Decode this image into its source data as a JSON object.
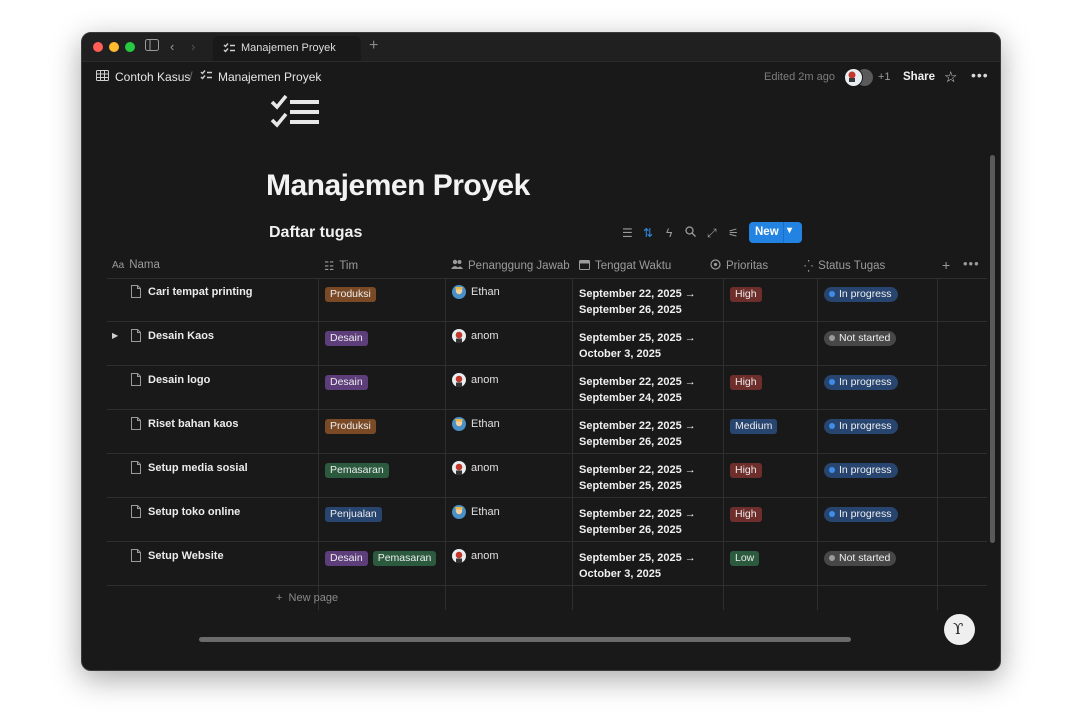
{
  "tab": {
    "label": "Manajemen Proyek"
  },
  "breadcrumb": [
    {
      "label": "Contoh Kasus",
      "icon": "table-icon"
    },
    {
      "label": "Manajemen Proyek",
      "icon": "checklist-icon"
    }
  ],
  "breadcrumb_sep": "/",
  "header": {
    "edited": "Edited 2m ago",
    "plus_count": "+1",
    "share": "Share"
  },
  "page": {
    "title": "Manajemen Proyek",
    "icon": "checklist-icon"
  },
  "view": {
    "title": "Daftar tugas",
    "new_label": "New"
  },
  "columns": [
    {
      "label": "Nama",
      "icon": "text-icon"
    },
    {
      "label": "Tim",
      "icon": "list-icon"
    },
    {
      "label": "Penanggung Jawab",
      "icon": "people-icon"
    },
    {
      "label": "Tenggat Waktu",
      "icon": "calendar-icon"
    },
    {
      "label": "Prioritas",
      "icon": "target-icon"
    },
    {
      "label": "Status Tugas",
      "icon": "loader-icon"
    }
  ],
  "rows": [
    {
      "name": "Cari tempat printing",
      "tags": [
        "Produksi"
      ],
      "person": "Ethan",
      "date1": "September 22, 2025 →",
      "date2": "September 26, 2025",
      "priority": "High",
      "status": "In progress"
    },
    {
      "name": "Desain Kaos",
      "tags": [
        "Desain"
      ],
      "person": "anom",
      "date1": "September 25, 2025 →",
      "date2": "October 3, 2025",
      "priority": "",
      "status": "Not started"
    },
    {
      "name": "Desain logo",
      "tags": [
        "Desain"
      ],
      "person": "anom",
      "date1": "September 22, 2025 →",
      "date2": "September 24, 2025",
      "priority": "High",
      "status": "In progress"
    },
    {
      "name": "Riset bahan kaos",
      "tags": [
        "Produksi"
      ],
      "person": "Ethan",
      "date1": "September 22, 2025 →",
      "date2": "September 26, 2025",
      "priority": "Medium",
      "status": "In progress"
    },
    {
      "name": "Setup media sosial",
      "tags": [
        "Pemasaran"
      ],
      "person": "anom",
      "date1": "September 22, 2025 →",
      "date2": "September 25, 2025",
      "priority": "High",
      "status": "In progress"
    },
    {
      "name": "Setup toko online",
      "tags": [
        "Penjualan"
      ],
      "person": "Ethan",
      "date1": "September 22, 2025 →",
      "date2": "September 26, 2025",
      "priority": "High",
      "status": "In progress"
    },
    {
      "name": "Setup Website",
      "tags": [
        "Desain",
        "Pemasaran"
      ],
      "person": "anom",
      "date1": "September 25, 2025 →",
      "date2": "October 3, 2025",
      "priority": "Low",
      "status": "Not started"
    }
  ],
  "new_page": "New page",
  "colors": {
    "tag_Produksi": "#7a4a27",
    "tag_Desain": "#5d3d7a",
    "tag_Pemasaran": "#2b5a3e",
    "tag_Penjualan": "#28456f",
    "prio_High": "#6e2e2b",
    "prio_Medium": "#28456f",
    "prio_Low": "#2b5a3e",
    "status_In progress": "#28456f",
    "status_Not started": "#474747",
    "dot_In progress": "#3d8ee8",
    "dot_Not started": "#9b9b9b",
    "accent": "#2383e2"
  }
}
